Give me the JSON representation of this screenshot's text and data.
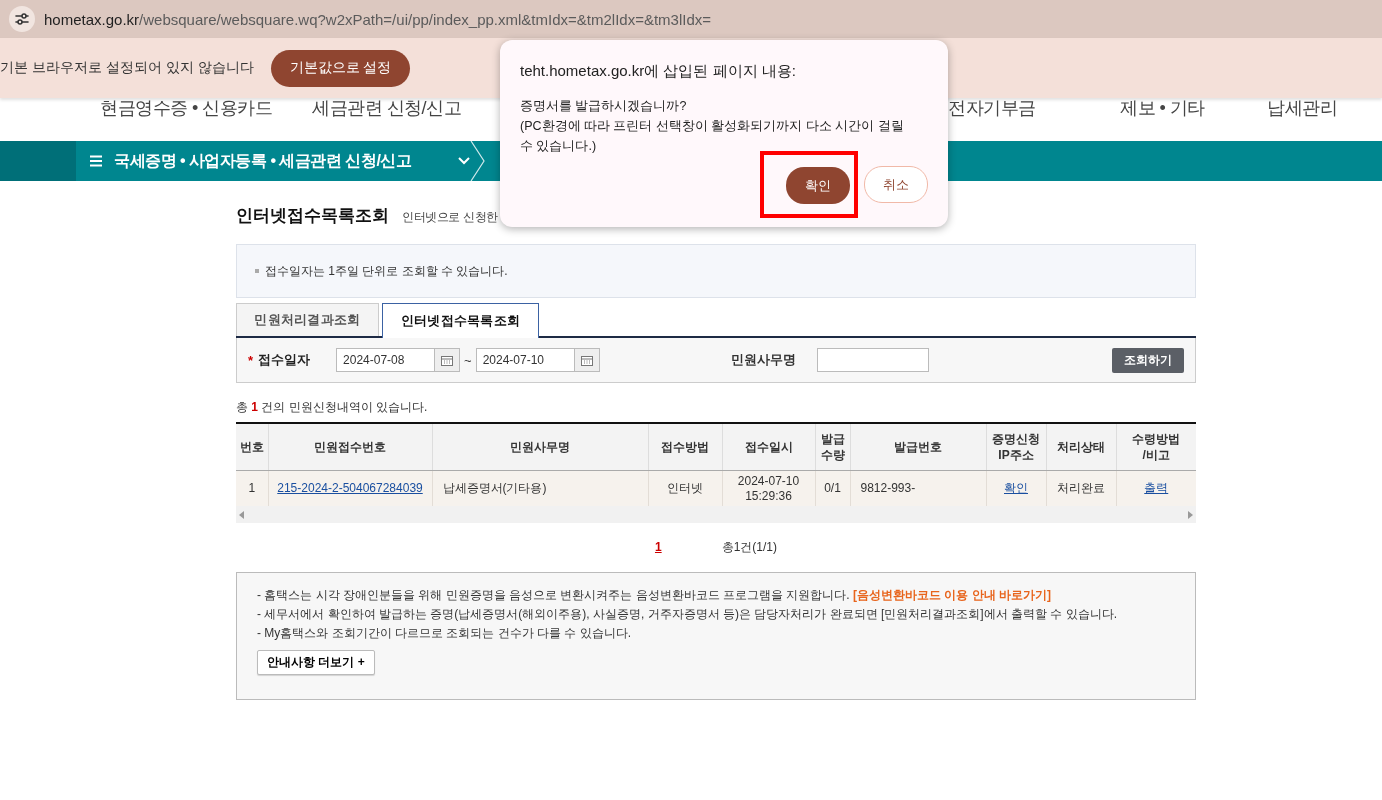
{
  "browser": {
    "url_host": "hometax.go.kr",
    "url_path": "/websquare/websquare.wq?w2xPath=/ui/pp/index_pp.xml&tmIdx=&tm2lIdx=&tm3lIdx="
  },
  "infobar": {
    "message": "기본 브라우저로 설정되어 있지 않습니다",
    "button": "기본값으로 설정"
  },
  "top_nav": [
    "현금영수증 • 신용카드",
    "세금관련 신청/신고",
    "전자기부금",
    "제보 • 기타",
    "납세관리"
  ],
  "menu_bar": {
    "label": "국세증명 • 사업자등록 • 세금관련 신청/신고"
  },
  "page": {
    "title": "인터넷접수목록조회",
    "subtitle": "인터넷으로 신청한"
  },
  "notice": "접수일자는 1주일 단위로 조회할 수 있습니다.",
  "tabs": [
    {
      "label": "민원처리결과조회",
      "selected": false
    },
    {
      "label": "인터넷접수목록조회",
      "selected": true
    }
  ],
  "search": {
    "required_mark": "*",
    "date_label": "접수일자",
    "date_from": "2024-07-08",
    "separator": "~",
    "date_to": "2024-07-10",
    "name_label": "민원사무명",
    "button": "조회하기"
  },
  "result_summary": "총 **1** 건의 민원신청내역이 있습니다.",
  "table": {
    "columns": [
      "번호",
      "민원접수번호",
      "민원사무명",
      "접수방법",
      "접수일시",
      "발급\n수량",
      "발급번호",
      "증명신청\nIP주소",
      "처리상태",
      "수령방법\n/비고"
    ],
    "rows": [
      {
        "cells": [
          {
            "kind": "text",
            "text": "1"
          },
          {
            "kind": "link",
            "text": "215-2024-2-504067284039"
          },
          {
            "kind": "text",
            "text": "납세증명서(기타용)"
          },
          {
            "kind": "text",
            "text": "인터넷"
          },
          {
            "kind": "text",
            "text": "2024-07-10\n15:29:36"
          },
          {
            "kind": "text",
            "text": "0/1"
          },
          {
            "kind": "text",
            "text": "9812-993-"
          },
          {
            "kind": "link",
            "text": "확인"
          },
          {
            "kind": "text",
            "text": "처리완료"
          },
          {
            "kind": "link",
            "text": "출력"
          }
        ]
      }
    ]
  },
  "pagination": {
    "pages": [
      {
        "label": "1",
        "selected": true
      }
    ],
    "summary": "총1건(1/1)"
  },
  "notes": {
    "items": [
      {
        "text": "- 홈택스는 시각 장애인분들을 위해 민원증명을 음성으로 변환시켜주는 음성변환바코드 프로그램을 지원합니다.",
        "link": "[음성변환바코드 이용 안내 바로가기]"
      },
      {
        "text": "- 세무서에서 확인하여 발급하는 증명(납세증명서(해외이주용), 사실증명, 거주자증명서 등)은 담당자처리가 완료되면 [민원처리결과조회]에서 출력할 수 있습니다."
      },
      {
        "text": "- My홈택스와 조회기간이 다르므로 조회되는 건수가 다를 수 있습니다."
      }
    ],
    "more_button": "안내사항 더보기 +"
  },
  "dialog": {
    "title": "teht.hometax.go.kr에 삽입된 페이지 내용:",
    "message": "증명서를 발급하시겠습니까?\n(PC환경에 따라 프린터 선택창이 활성화되기까지 다소 시간이 걸릴 수 있습니다.)",
    "buttons": [
      {
        "label": "확인",
        "kind": "primary",
        "highlighted": true
      },
      {
        "label": "취소",
        "kind": "secondary",
        "highlighted": false
      }
    ]
  }
}
